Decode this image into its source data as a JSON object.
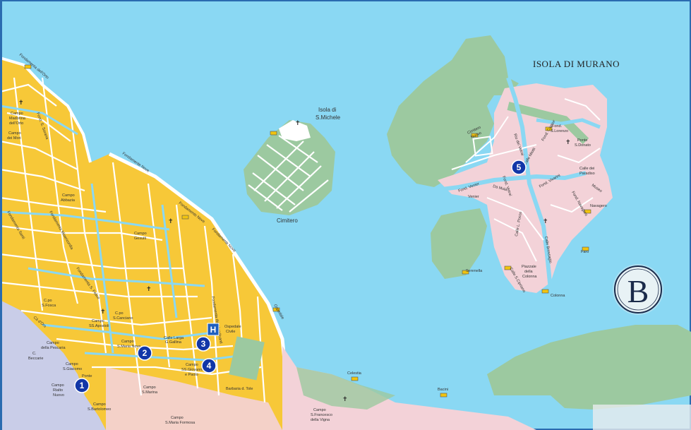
{
  "colors": {
    "water": "#8ad8f3",
    "land_yellow": "#f7c838",
    "land_pink": "#f3d2d8",
    "land_green": "#9cc9a0",
    "land_blue": "#c9cde8",
    "street": "#ffffff",
    "marker": "#1237a8",
    "hospital": "#1e5fbf"
  },
  "icons": {
    "church": "church-cross-icon",
    "vaporetto": "vaporetto-stop-icon",
    "hospital": "hospital-icon",
    "badge": "compass-badge-icon"
  },
  "labels": {
    "murano": "ISOLA DI MURANO",
    "isola_michele_1": "Isola di",
    "isola_michele_2": "S.Michele",
    "cimitero": "Cimitero",
    "badge_letter": "B"
  },
  "markers": {
    "m1": "1",
    "m2": "2",
    "m3": "3",
    "m4": "4",
    "m5": "5",
    "hospital": "H"
  },
  "places": {
    "fond_nove_1": "Fondamente Nove",
    "fond_nove_2": "Fondamente Nove",
    "fond_nove_3": "Fondamente Nove",
    "ospedale": "Ospedale",
    "ospedale_civile_1": "Ospedale",
    "ospedale_civile_2": "Civile",
    "campo_gesuiti_1": "Campo",
    "campo_gesuiti_2": "Gesuiti",
    "campo_abbazia_1": "Campo",
    "campo_abbazia_2": "Abbazia",
    "campo_madonna_1": "Campo",
    "campo_madonna_2": "Madonna",
    "campo_madonna_3": "dell'Orto",
    "campo_mori_1": "Campo",
    "campo_mori_2": "dei Mori",
    "campo_apostoli_1": "Campo",
    "campo_apostoli_2": "SS.Apostoli",
    "campo_smaria_1": "Campo",
    "campo_smaria_2": "S.Maria Nova",
    "calle_larga": "Calle Larga",
    "gallina": "G.Gallina",
    "campo_ssgiovanni_1": "Campo",
    "campo_ssgiovanni_2": "SS.Giovanni",
    "campo_ssgiovanni_3": "e Paolo",
    "campo_smarina_1": "Campo",
    "campo_smarina_2": "S.Marina",
    "campo_pescaria_1": "Campo",
    "campo_pescaria_2": "della Pescaria",
    "campo_beccarie_1": "C.",
    "campo_beccarie_2": "Beccarie",
    "campo_sgiacomo_1": "Campo",
    "campo_sgiacomo_2": "S.Giacomo",
    "campo_rialto_1": "Campo",
    "campo_rialto_2": "Rialto",
    "campo_rialto_3": "Nuovo",
    "ponte_rialto": "Ponte",
    "campo_sbartolomeo_1": "Campo",
    "campo_sbartolomeo_2": "S.Bartolomeo",
    "campo_sfosca_1": "C.po",
    "campo_sfosca_2": "S.Fosca",
    "ca_doro": "Cà d'Oro",
    "campo_scanciano_1": "C.po",
    "campo_scanciano_2": "S.Canciano",
    "campo_smaria_formosa_1": "Campo",
    "campo_smaria_formosa_2": "S.Maria Formosa",
    "campo_sfrancesco_1": "Campo",
    "campo_sfrancesco_2": "S.Francesco",
    "campo_sfrancesco_3": "della Vigna",
    "celestia": "Celestia",
    "bacini": "Bacini",
    "barbaria": "Barbaria d. Tole",
    "fond_orto": "Fondamenta dell'Orto",
    "fond_sorana": "Fond. S. Sorana",
    "fond_mendicanti": "Fondamenta dei Mendicanti",
    "fond_sfelice": "Fondamenta S. Felice",
    "fond_misericordia": "Fondamenta Misericordia",
    "fond_santi": "Fondamenta Santi",
    "murano_venier": "Venier",
    "murano_serenella": "Serenella",
    "murano_colonna": "Colonna",
    "murano_faro": "Faro",
    "murano_navagero": "Navagero",
    "murano_museo": "Museo",
    "murano_cimitero_1": "Cimitero",
    "murano_cimitero_2": "Nuovo",
    "murano_fond_slorenzo_1": "Fond.",
    "murano_fond_slorenzo_2": "S.Lorenzo",
    "murano_ponte_sdonato_1": "Ponte",
    "murano_ponte_sdonato_2": "S.Donato",
    "murano_calle_paradiso_1": "Calle dei",
    "murano_calle_paradiso_2": "Paradiso",
    "murano_piazzale_1": "Piazzale",
    "murano_piazzale_2": "della",
    "murano_piazzale_3": "Colonna",
    "murano_de_mula": "Da Mula",
    "murano_fond_venier": "Fond. Venier",
    "murano_vivarini": "Fond. Vivarini",
    "murano_rio_vetrai": "Rio dei Vetrai",
    "murano_calle_vetrai": "Fond. Vetrai",
    "murano_ponte_vivarini": "Ponte Vivarini",
    "murano_calle_s_cipriano": "Calle S.Cipriano",
    "murano_fond_cavour": "Fond. Cavour",
    "murano_calle_miotti": "Calle Miotti",
    "murano_calle_bressagio": "Calle Bressagio",
    "murano_fond_navagero": "Fond. Navagero",
    "murano_vicenzo": "Calle L. Pocco"
  }
}
